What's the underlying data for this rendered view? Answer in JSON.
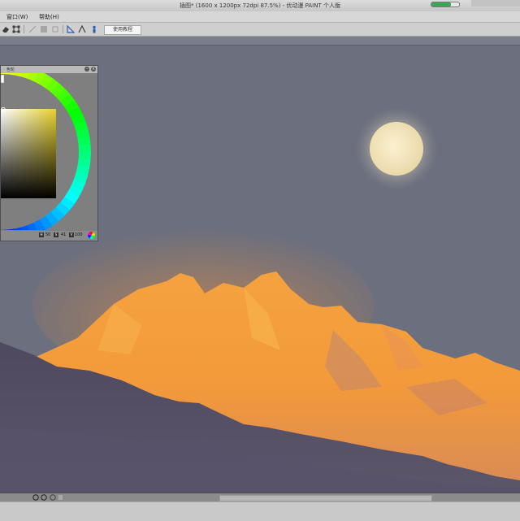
{
  "window": {
    "title": "插图* (1600 x 1200px 72dpi 87.5%)  - 优动漫 PAINT 个人版",
    "memory_usage_fraction": 0.72,
    "accent_color": "#39a854"
  },
  "menu": {
    "items": [
      {
        "label": "窗口(W)"
      },
      {
        "label": "帮助(H)"
      }
    ]
  },
  "toolbar": {
    "icons": [
      "eraser-icon",
      "transform-icon",
      "select-icon",
      "fill-icon",
      "layer-icon",
      "ruler-icon",
      "perspective-icon",
      "figure-icon"
    ],
    "tutorial_label": "使用教程"
  },
  "color_panel": {
    "title": "色轮",
    "values": {
      "hue": "50",
      "saturation": "41",
      "value": "100"
    },
    "selected_color": "#e8d22b"
  },
  "canvas": {
    "background_color": "#6b6f7e",
    "moon_color": "#f3e6bf",
    "mountain_color": "#f39a3a",
    "foreground_color": "#4a4559"
  }
}
